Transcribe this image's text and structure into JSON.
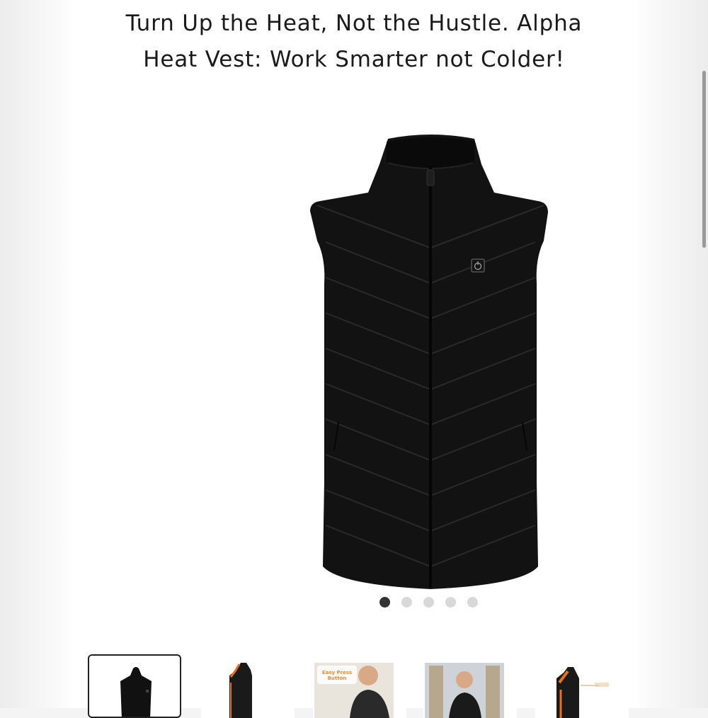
{
  "product": {
    "title_line1": "Turn Up the Heat, Not the Hustle. Alpha",
    "title_line2": "Heat Vest: Work Smarter not Colder!"
  },
  "gallery": {
    "slide_count": 5,
    "active_slide": 1,
    "thumbnails": [
      {
        "icon": "vest-front-icon",
        "selected": true
      },
      {
        "icon": "vest-heated-icon",
        "selected": false
      },
      {
        "icon": "person-vest-icon",
        "badge": "Easy Press Button",
        "selected": false
      },
      {
        "icon": "person-vest-icon",
        "selected": false
      },
      {
        "icon": "vest-heated-icon",
        "selected": false
      }
    ]
  },
  "colors": {
    "vest": "#111111",
    "heat_accent": "#e8701f",
    "active_dot": "#333333",
    "inactive_dot": "#d8d8d8"
  }
}
